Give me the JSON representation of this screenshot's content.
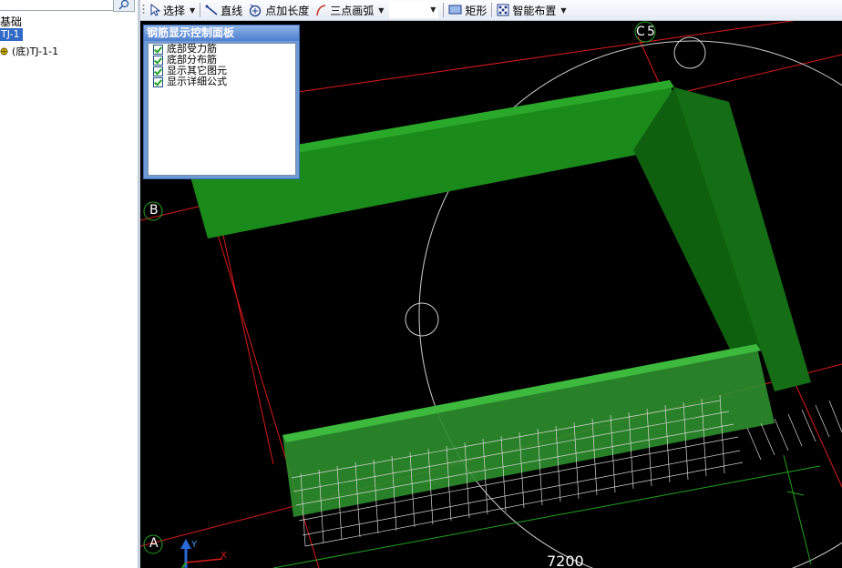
{
  "tree": {
    "root": "基础",
    "selected": "TJ-1",
    "child": "(底)TJ-1-1"
  },
  "toolbar": {
    "select": "选择",
    "line": "直线",
    "point_length": "点加长度",
    "three_point_arc": "三点画弧",
    "rectangle": "矩形",
    "smart_layout": "智能布置"
  },
  "panel": {
    "title": "钢筋显示控制面板",
    "items": [
      "底部受力筋",
      "底部分布筋",
      "显示其它图元",
      "显示详细公式"
    ]
  },
  "canvas": {
    "axis_c": "C",
    "axis_5": "5",
    "axis_b": "B",
    "axis_a": "A",
    "dimension": "7200",
    "ucs_y": "Y",
    "ucs_x": "X"
  },
  "colors": {
    "background": "#000000",
    "grid_line": "#e01a1a",
    "beam": "#1f8a1f",
    "dimension_line": "#21a421",
    "panel_title": "#4d7fd0"
  }
}
